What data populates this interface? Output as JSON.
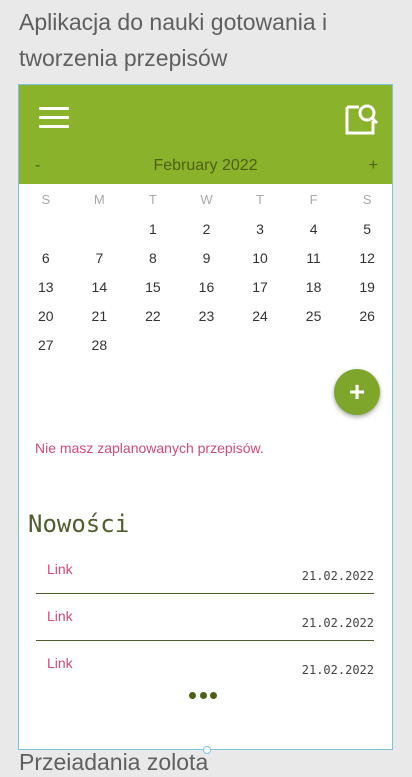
{
  "page_title": "Aplikacja do nauki gotowania i tworzenia przepisów",
  "bottom_peek_text": "Przeiadania zolota",
  "app": {
    "colors": {
      "topbar": "#8ab22a",
      "accent": "#7ea62a",
      "link": "#d24a79",
      "dark_green": "#4e5f18"
    },
    "icons": {
      "menu": "menu-icon",
      "search_doc": "search-document-icon",
      "add": "add-icon",
      "more": "more-dots-icon"
    },
    "calendar": {
      "prev_label": "-",
      "month_label": "February 2022",
      "next_label": "+",
      "weekdays": [
        "S",
        "M",
        "T",
        "W",
        "T",
        "F",
        "S"
      ],
      "weeks": [
        [
          "",
          "",
          "1",
          "2",
          "3",
          "4",
          "5"
        ],
        [
          "6",
          "7",
          "8",
          "9",
          "10",
          "11",
          "12"
        ],
        [
          "13",
          "14",
          "15",
          "16",
          "17",
          "18",
          "19"
        ],
        [
          "20",
          "21",
          "22",
          "23",
          "24",
          "25",
          "26"
        ],
        [
          "27",
          "28",
          "",
          "",
          "",
          "",
          ""
        ]
      ]
    },
    "fab_label": "+",
    "empty_message": "Nie masz zaplanowanych przepisów.",
    "news": {
      "title": "Nowości",
      "items": [
        {
          "link": "Link",
          "date": "21.02.2022"
        },
        {
          "link": "Link",
          "date": "21.02.2022"
        },
        {
          "link": "Link",
          "date": "21.02.2022"
        }
      ]
    }
  }
}
